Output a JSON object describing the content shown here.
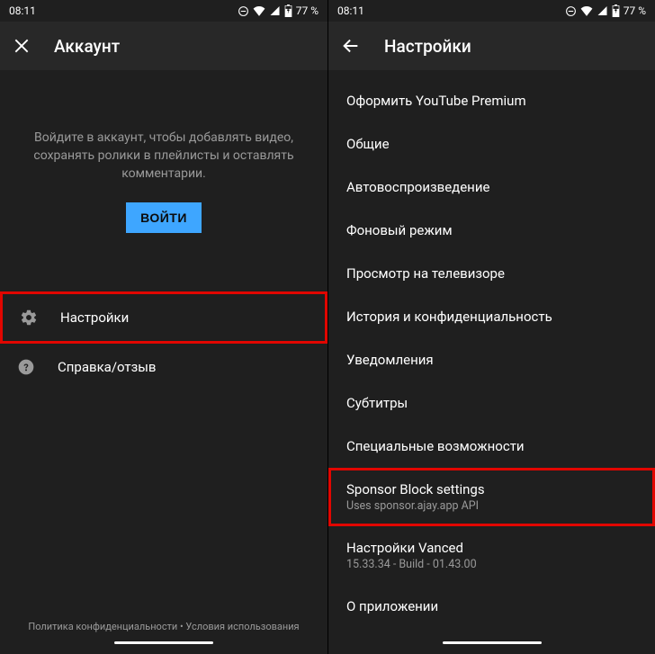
{
  "status": {
    "time": "08:11",
    "battery": "77 %"
  },
  "left": {
    "title": "Аккаунт",
    "signin_message": "Войдите в аккаунт, чтобы добавлять видео, сохранять ролики в плейлисты и оставлять комментарии.",
    "signin_button": "ВОЙТИ",
    "menu": {
      "settings": "Настройки",
      "help": "Справка/отзыв"
    },
    "legal": {
      "privacy": "Политика конфиденциальности",
      "sep": " • ",
      "terms": "Условия использования"
    }
  },
  "right": {
    "title": "Настройки",
    "items": [
      {
        "label": "Оформить YouTube Premium"
      },
      {
        "label": "Общие"
      },
      {
        "label": "Автовоспроизведение"
      },
      {
        "label": "Фоновый режим"
      },
      {
        "label": "Просмотр на телевизоре"
      },
      {
        "label": "История и конфиденциальность"
      },
      {
        "label": "Уведомления"
      },
      {
        "label": "Субтитры"
      },
      {
        "label": "Специальные возможности"
      },
      {
        "label": "Sponsor Block settings",
        "sub": "Uses sponsor.ajay.app API",
        "highlight": true
      },
      {
        "label": "Настройки Vanced",
        "sub": "15.33.34 - Build - 01.43.00"
      },
      {
        "label": "О приложении"
      }
    ]
  }
}
